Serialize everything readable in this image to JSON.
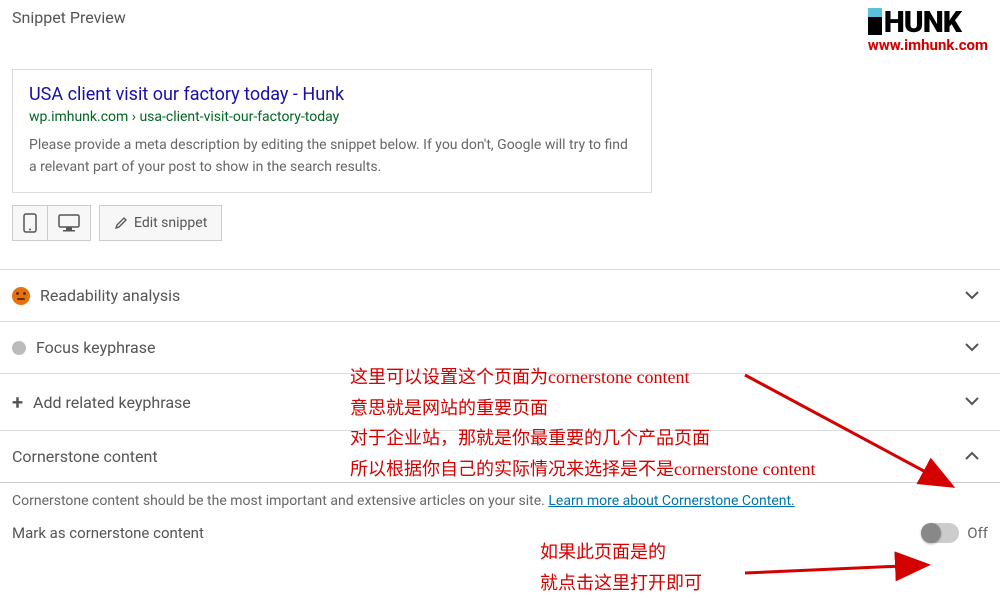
{
  "header": {
    "snippet_preview_label": "Snippet Preview",
    "logo_brand": "HUNK",
    "logo_url": "www.imhunk.com"
  },
  "preview": {
    "title": "USA client visit our factory today - Hunk",
    "url": "wp.imhunk.com › usa-client-visit-our-factory-today",
    "description": "Please provide a meta description by editing the snippet below. If you don't, Google will try to find a relevant part of your post to show in the search results."
  },
  "buttons": {
    "edit_snippet": "Edit snippet"
  },
  "sections": {
    "readability": "Readability analysis",
    "focus_keyphrase": "Focus keyphrase",
    "add_related": "Add related keyphrase",
    "cornerstone": "Cornerstone content"
  },
  "cornerstone": {
    "help_prefix": "Cornerstone content should be the most important and extensive articles on your site. ",
    "link_text": "Learn more about Cornerstone Content.",
    "mark_label": "Mark as cornerstone content",
    "toggle_state": "Off"
  },
  "annotations": {
    "a1l1": "这里可以设置这个页面为cornerstone content",
    "a1l2": "意思就是网站的重要页面",
    "a1l3": "对于企业站，那就是你最重要的几个产品页面",
    "a1l4": "所以根据你自己的实际情况来选择是不是cornerstone content",
    "a2l1": "如果此页面是的",
    "a2l2": "就点击这里打开即可"
  }
}
